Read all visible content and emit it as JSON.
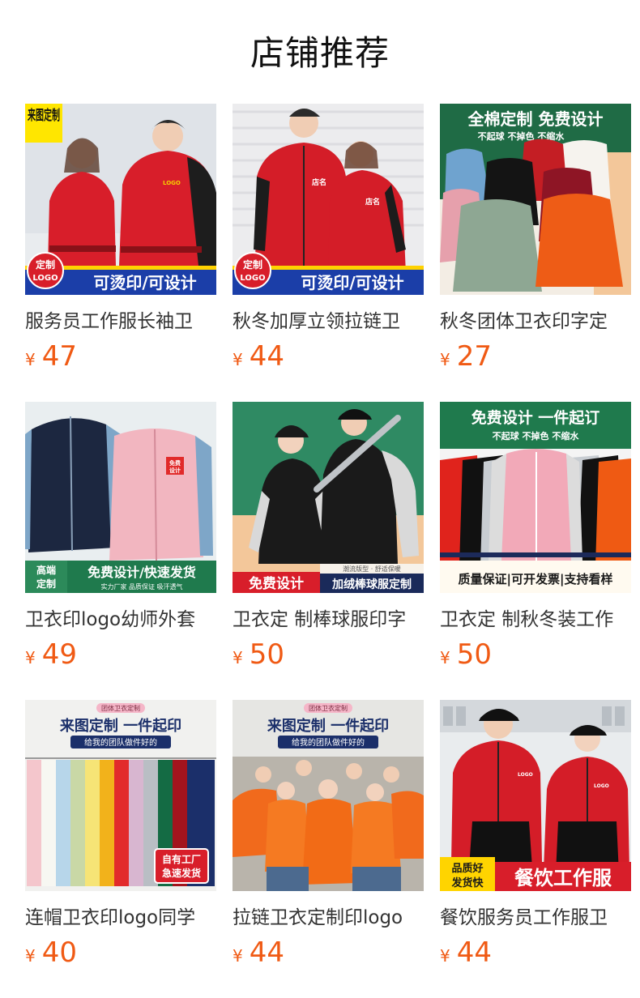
{
  "page": {
    "title": "店铺推荐"
  },
  "theme": {
    "price_color": "#f05a14",
    "title_color": "#111111",
    "text_color": "#333333"
  },
  "products": [
    {
      "name": "服务员工作服长袖卫",
      "currency": "¥",
      "price": "47",
      "image": {
        "corner_badge": "来图定制",
        "round_badge": [
          "定制",
          "LOGO"
        ],
        "banner": "可烫印/可设计",
        "chest_print": "LOGO"
      }
    },
    {
      "name": "秋冬加厚立领拉链卫",
      "currency": "¥",
      "price": "44",
      "image": {
        "round_badge": [
          "定制",
          "LOGO"
        ],
        "banner": "可烫印/可设计",
        "chest_print": "店名"
      }
    },
    {
      "name": "秋冬团体卫衣印字定",
      "currency": "¥",
      "price": "27",
      "image": {
        "headline": "全棉定制 免费设计",
        "subline": "不起球 不掉色 不缩水"
      }
    },
    {
      "name": "卫衣印logo幼师外套",
      "currency": "¥",
      "price": "49",
      "image": {
        "left_badge": [
          "高端",
          "定制"
        ],
        "banner": "免费设计/快速发货",
        "banner_sub": "实力厂家  品质保证  吸汗透气",
        "chest_print": [
          "免费",
          "设计"
        ]
      }
    },
    {
      "name": "卫衣定 制棒球服印字",
      "currency": "¥",
      "price": "50",
      "image": {
        "banner_left": "免费设计",
        "banner_tag": "潮流版型 · 舒适保暖",
        "banner_right": "加绒棒球服定制"
      }
    },
    {
      "name": "卫衣定 制秋冬装工作",
      "currency": "¥",
      "price": "50",
      "image": {
        "headline": "免费设计 一件起订",
        "subline": "不起球 不掉色 不缩水",
        "banner": "质量保证|可开发票|支持看样"
      }
    },
    {
      "name": "连帽卫衣印logo同学",
      "currency": "¥",
      "price": "40",
      "image": {
        "tag": "团体卫衣定制",
        "headline": "来图定制  一件起印",
        "subline": "给我的团队做件好的",
        "badge": [
          "自有工厂",
          "急速发货"
        ]
      }
    },
    {
      "name": "拉链卫衣定制印logo",
      "currency": "¥",
      "price": "44",
      "image": {
        "tag": "团体卫衣定制",
        "headline": "来图定制  一件起印",
        "subline": "给我的团队做件好的"
      }
    },
    {
      "name": "餐饮服务员工作服卫",
      "currency": "¥",
      "price": "44",
      "image": {
        "badge": [
          "品质好",
          "发货快"
        ],
        "banner": "餐饮工作服",
        "chest_print": "LOGO"
      }
    }
  ]
}
